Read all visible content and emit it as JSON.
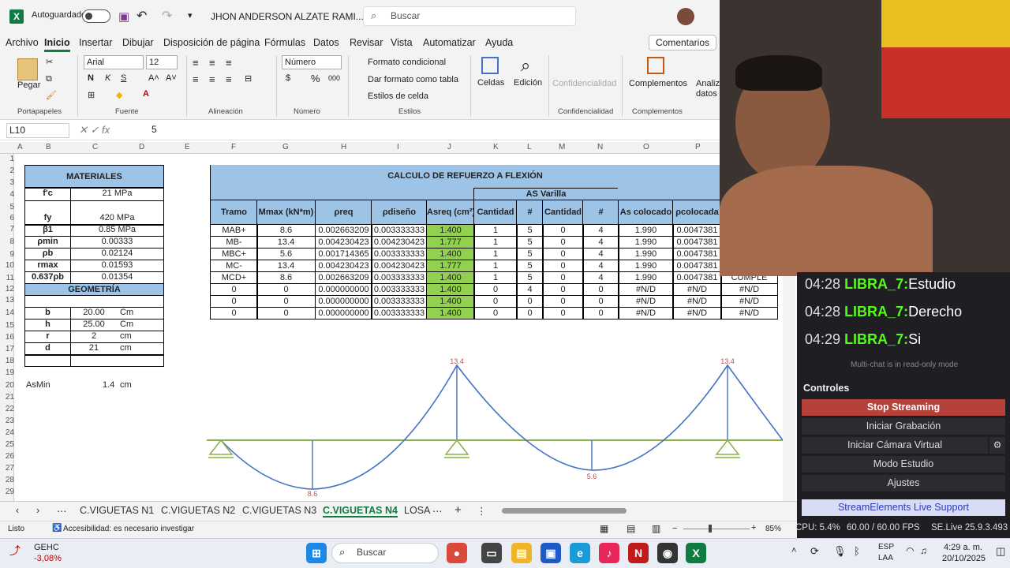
{
  "titlebar": {
    "autosave": "Autoguardado",
    "doc_name": "JHON ANDERSON ALZATE RAMI...",
    "search": "Buscar"
  },
  "menu": [
    "Archivo",
    "Inicio",
    "Insertar",
    "Dibujar",
    "Disposición de página",
    "Fórmulas",
    "Datos",
    "Revisar",
    "Vista",
    "Automatizar",
    "Ayuda"
  ],
  "comentarios": "Comentarios",
  "ribbon": {
    "paste": "Pegar",
    "clipboard": "Portapapeles",
    "font_name": "Arial",
    "font_size": "12",
    "font_group": "Fuente",
    "align_group": "Alineación",
    "number_format": "Número",
    "number_group": "Número",
    "cond_format": "Formato condicional",
    "table_format": "Dar formato como tabla",
    "cell_styles": "Estilos de celda",
    "styles_group": "Estilos",
    "cells": "Celdas",
    "edit": "Edición",
    "conf": "Confidencialidad",
    "conf_group": "Confidencialidad",
    "complements": "Complementos",
    "complements_group": "Complementos",
    "analyze": "Analiz datos"
  },
  "formula": {
    "cell": "L10",
    "fx": "fx",
    "value": "5"
  },
  "columns": [
    "A",
    "B",
    "C",
    "D",
    "E",
    "F",
    "G",
    "H",
    "I",
    "J",
    "K",
    "L",
    "M",
    "N",
    "O",
    "P"
  ],
  "rows": [
    "1",
    "2",
    "3",
    "4",
    "5",
    "6",
    "7",
    "8",
    "9",
    "10",
    "11",
    "12",
    "13",
    "14",
    "15",
    "16",
    "17",
    "18",
    "19",
    "20",
    "21",
    "22",
    "23",
    "24",
    "25",
    "26",
    "27",
    "28",
    "29"
  ],
  "materiales": {
    "title": "MATERIALES",
    "rows": [
      [
        "f'c",
        "21 MPa"
      ],
      [
        "fy",
        "420 MPa"
      ],
      [
        "β1",
        "0.85 MPa"
      ],
      [
        "ρmin",
        "0.00333"
      ],
      [
        "ρb",
        "0.02124"
      ],
      [
        "rmax",
        "0.01593"
      ],
      [
        "0.637ρb",
        "0.01354"
      ]
    ]
  },
  "geometria": {
    "title": "GEOMETRÍA",
    "rows": [
      [
        "b",
        "20.00",
        "Cm"
      ],
      [
        "h",
        "25.00",
        "Cm"
      ],
      [
        "r",
        "2",
        "cm"
      ],
      [
        "d",
        "21",
        "cm"
      ]
    ]
  },
  "asmin": {
    "label": "AsMin",
    "value": "1.4",
    "unit": "cm"
  },
  "calculo": {
    "title": "CALCULO DE REFUERZO A FLEXIÓN",
    "as_varilla": "AS Varilla",
    "headers": [
      "Tramo",
      "Mmax (kN*m)",
      "ρreq",
      "ρdiseño",
      "Asreq (cm²)",
      "Cantidad",
      "#",
      "Cantidad",
      "#",
      "As colocado",
      "ρcolocada",
      ""
    ],
    "rows": [
      [
        "MAB+",
        "8.6",
        "0.002663209",
        "0.003333333",
        "1.400",
        "1",
        "5",
        "0",
        "4",
        "1.990",
        "0.0047381",
        ""
      ],
      [
        "MB-",
        "13.4",
        "0.004230423",
        "0.004230423",
        "1.777",
        "1",
        "5",
        "0",
        "4",
        "1.990",
        "0.0047381",
        ""
      ],
      [
        "MBC+",
        "5.6",
        "0.001714365",
        "0.003333333",
        "1.400",
        "1",
        "5",
        "0",
        "4",
        "1.990",
        "0.0047381",
        ""
      ],
      [
        "MC-",
        "13.4",
        "0.004230423",
        "0.004230423",
        "1.777",
        "1",
        "5",
        "0",
        "4",
        "1.990",
        "0.0047381",
        ""
      ],
      [
        "MCD+",
        "8.6",
        "0.002663209",
        "0.003333333",
        "1.400",
        "1",
        "5",
        "0",
        "4",
        "1.990",
        "0.0047381",
        "CUMPLE"
      ],
      [
        "0",
        "0",
        "0.000000000",
        "0.003333333",
        "1.400",
        "0",
        "4",
        "0",
        "0",
        "#N/D",
        "#N/D",
        "#N/D"
      ],
      [
        "0",
        "0",
        "0.000000000",
        "0.003333333",
        "1.400",
        "0",
        "0",
        "0",
        "0",
        "#N/D",
        "#N/D",
        "#N/D"
      ],
      [
        "0",
        "0",
        "0.000000000",
        "0.003333333",
        "1.400",
        "0",
        "0",
        "0",
        "0",
        "#N/D",
        "#N/D",
        "#N/D"
      ]
    ]
  },
  "chart_labels": {
    "peak1": "13.4",
    "peak2": "13.4",
    "low1": "8.6",
    "low2": "5.6"
  },
  "tabs": [
    "C.VIGUETAS N1",
    "C.VIGUETAS N2",
    "C.VIGUETAS N3",
    "C.VIGUETAS N4",
    "LOSA"
  ],
  "status": {
    "ready": "Listo",
    "access": "Accesibilidad: es necesario investigar",
    "zoom": "85%"
  },
  "obs": {
    "chat": [
      [
        "04:28",
        "LIBRA_7:",
        "Estudio"
      ],
      [
        "04:28",
        "LIBRA_7:",
        "Derecho"
      ],
      [
        "04:29",
        "LIBRA_7:",
        "Si"
      ]
    ],
    "readonly": "Multi-chat is in read-only mode",
    "controles": "Controles",
    "buttons": [
      "Stop Streaming",
      "Iniciar Grabación",
      "Iniciar Cámara Virtual",
      "Modo Estudio",
      "Ajustes"
    ],
    "support": "StreamElements Live Support",
    "cpu": "CPU: 5.4%",
    "fps": "60.00 / 60.00 FPS",
    "version": "SE.Live 25.9.3.493"
  },
  "taskbar": {
    "stock_name": "GEHC",
    "stock_change": "-3,08%",
    "search": "Buscar",
    "lang1": "ESP",
    "lang2": "LAA",
    "time": "4:29 a. m.",
    "date": "20/10/2025"
  }
}
